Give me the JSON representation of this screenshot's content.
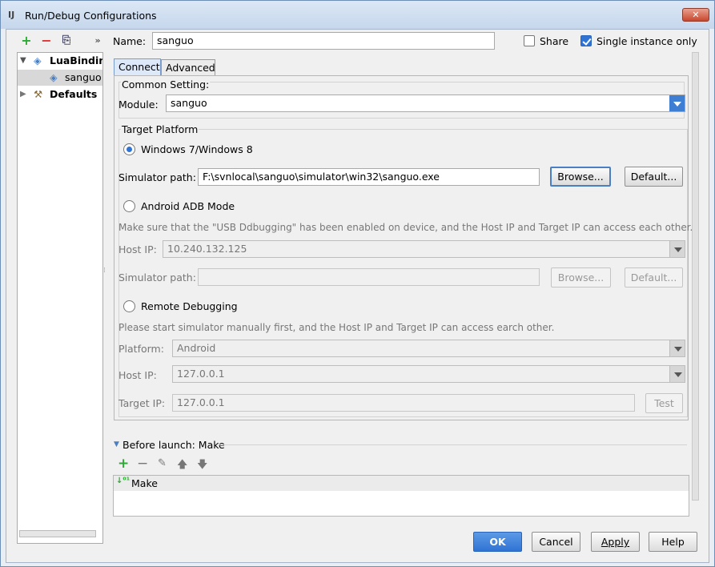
{
  "window": {
    "title": "Run/Debug Configurations",
    "close": "✕"
  },
  "toolbar": {
    "add": "+",
    "remove": "−",
    "copy": "⎘",
    "more": "»"
  },
  "tree": {
    "items": [
      {
        "label": "LuaBinding"
      },
      {
        "label": "sanguo"
      },
      {
        "label": "Defaults"
      }
    ]
  },
  "name": {
    "label": "Name:",
    "value": "sanguo"
  },
  "share": {
    "label": "Share",
    "checked": false
  },
  "single_instance": {
    "label": "Single instance only",
    "checked": true
  },
  "tabs": [
    {
      "label": "Connect"
    },
    {
      "label": "Advanced"
    }
  ],
  "common": {
    "title": "Common Setting:",
    "module_label": "Module:",
    "module_value": "sanguo"
  },
  "platform": {
    "title": "Target Platform",
    "windows": {
      "label": "Windows 7/Windows 8",
      "selected": true,
      "sim_label": "Simulator path:",
      "sim_value": "F:\\svnlocal\\sanguo\\simulator\\win32\\sanguo.exe",
      "browse": "Browse...",
      "default": "Default..."
    },
    "android": {
      "label": "Android ADB Mode",
      "selected": false,
      "note": "Make sure that the \"USB Ddbugging\" has been enabled on device, and the Host IP and Target IP can access each other.",
      "host_label": "Host IP:",
      "host_value": "10.240.132.125",
      "sim_label": "Simulator path:",
      "sim_value": "",
      "browse": "Browse...",
      "default": "Default..."
    },
    "remote": {
      "label": "Remote Debugging",
      "selected": false,
      "note": "Please start simulator manually first, and the Host IP and Target IP can access earch other.",
      "platform_label": "Platform:",
      "platform_value": "Android",
      "host_label": "Host IP:",
      "host_value": "127.0.0.1",
      "target_label": "Target IP:",
      "target_value": "127.0.0.1",
      "test": "Test"
    }
  },
  "before_launch": {
    "title": "Before launch: Make",
    "items": [
      {
        "label": "Make"
      }
    ]
  },
  "footer": {
    "ok": "OK",
    "cancel": "Cancel",
    "apply": "Apply",
    "help": "Help"
  }
}
